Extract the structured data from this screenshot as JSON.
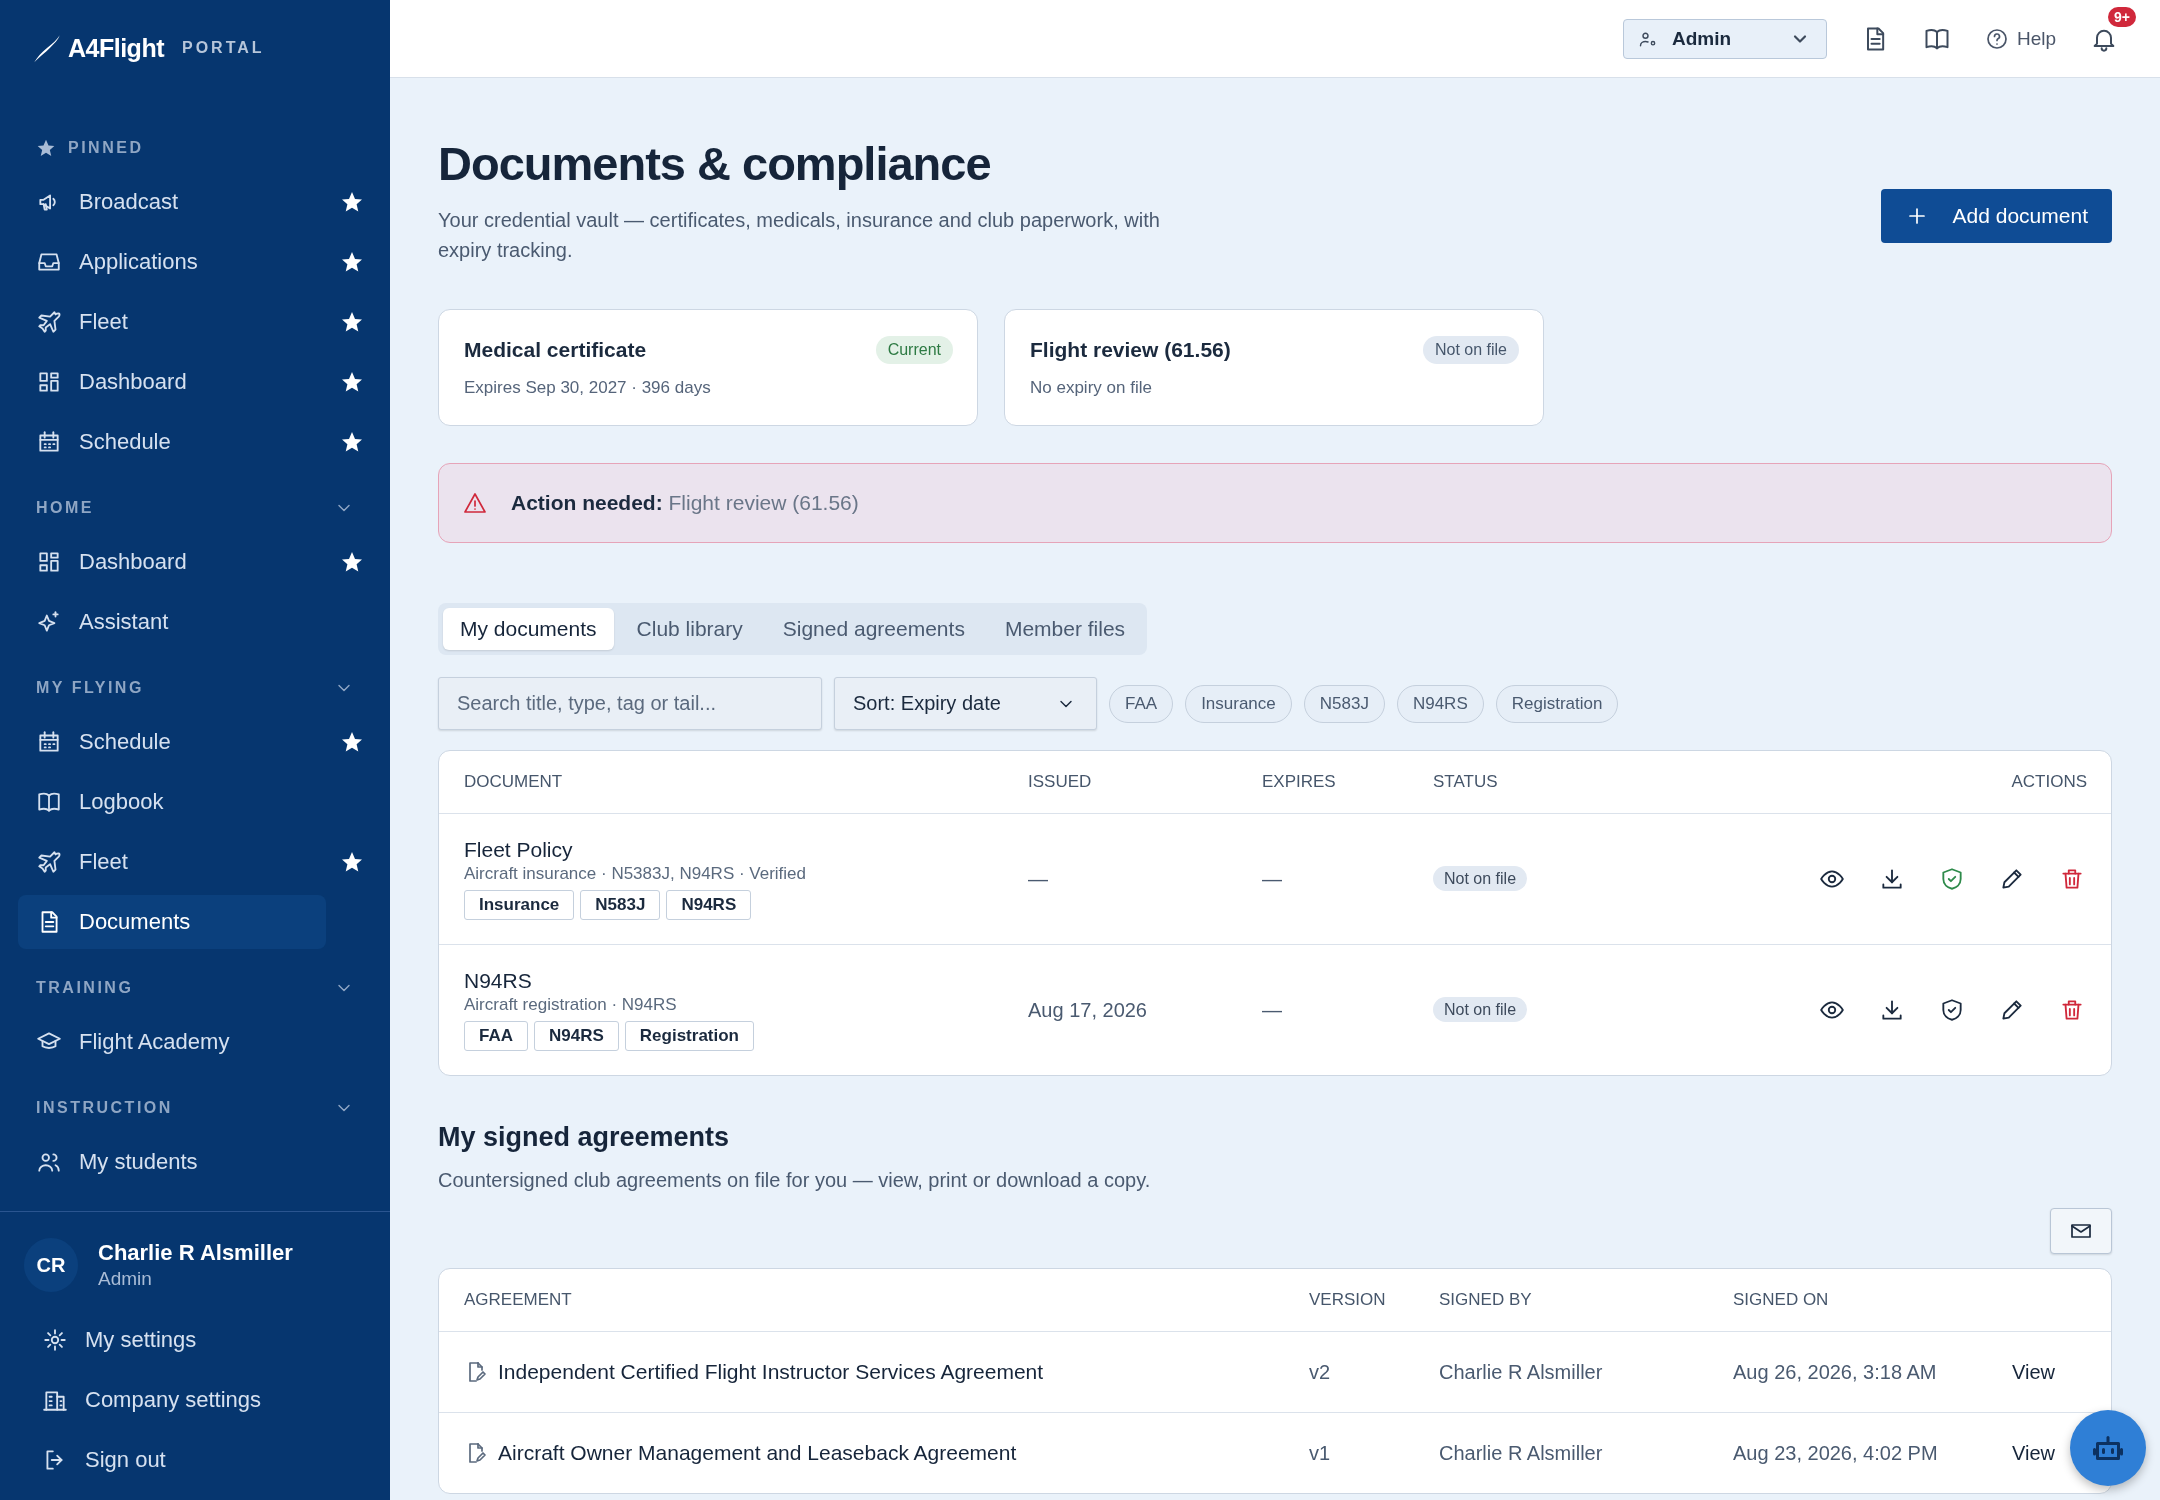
{
  "brand": {
    "name": "A4Flight",
    "tag": "PORTAL"
  },
  "sidebar": {
    "sections": [
      {
        "kind": "pinned",
        "title": "PINNED",
        "items": [
          {
            "label": "Broadcast",
            "pinned": true,
            "selected": false
          },
          {
            "label": "Applications",
            "pinned": true,
            "selected": false
          },
          {
            "label": "Fleet",
            "pinned": true,
            "selected": false
          },
          {
            "label": "Dashboard",
            "pinned": true,
            "selected": false
          },
          {
            "label": "Schedule",
            "pinned": true,
            "selected": false
          }
        ]
      },
      {
        "kind": "group",
        "title": "HOME",
        "expanded": true,
        "items": [
          {
            "label": "Dashboard",
            "pinned": true,
            "selected": false
          },
          {
            "label": "Assistant",
            "pinned": false,
            "selected": false
          }
        ]
      },
      {
        "kind": "group",
        "title": "MY FLYING",
        "expanded": true,
        "items": [
          {
            "label": "Schedule",
            "pinned": true,
            "selected": false
          },
          {
            "label": "Logbook",
            "pinned": false,
            "selected": false
          },
          {
            "label": "Fleet",
            "pinned": true,
            "selected": false
          },
          {
            "label": "Documents",
            "pinned": false,
            "selected": true
          }
        ]
      },
      {
        "kind": "group",
        "title": "TRAINING",
        "expanded": true,
        "items": [
          {
            "label": "Flight Academy",
            "pinned": false,
            "selected": false
          }
        ]
      },
      {
        "kind": "group",
        "title": "INSTRUCTION",
        "expanded": true,
        "items": [
          {
            "label": "My students",
            "pinned": false,
            "selected": false
          }
        ]
      }
    ],
    "user": {
      "initials": "CR",
      "name": "Charlie R Alsmiller",
      "role": "Admin"
    },
    "account_links": [
      "My settings",
      "Company settings",
      "Sign out"
    ]
  },
  "topbar": {
    "role_select": "Admin",
    "help": "Help",
    "notifications": "9+"
  },
  "page": {
    "title": "Documents & compliance",
    "subtitle": "Your credential vault — certificates, medicals, insurance and club paperwork, with expiry tracking.",
    "add_button": "Add document"
  },
  "status_cards": [
    {
      "title": "Medical certificate",
      "badge": "Current",
      "current": true,
      "detail": "Expires Sep 30, 2027 · 396 days"
    },
    {
      "title": "Flight review (61.56)",
      "badge": "Not on file",
      "current": false,
      "detail": "No expiry on file"
    }
  ],
  "alert": {
    "text": "**Action needed:** Flight review (61.56)"
  },
  "tabs": [
    {
      "label": "My documents",
      "selected": true
    },
    {
      "label": "Club library",
      "selected": false
    },
    {
      "label": "Signed agreements",
      "selected": false
    },
    {
      "label": "Member files",
      "selected": false
    }
  ],
  "search": {
    "placeholder": "Search title, type, tag or tail..."
  },
  "sort": "Sort: Expiry date",
  "filter_chips": [
    {
      "label": "FAA",
      "selected": false
    },
    {
      "label": "Insurance",
      "selected": false
    },
    {
      "label": "N583J",
      "selected": false
    },
    {
      "label": "N94RS",
      "selected": false
    },
    {
      "label": "Registration",
      "selected": false
    }
  ],
  "documents": {
    "columns": [
      "DOCUMENT",
      "ISSUED",
      "EXPIRES",
      "STATUS",
      "ACTIONS"
    ],
    "rows": [
      {
        "title": "Fleet Policy",
        "subtitle": "Aircraft insurance · N5383J, N94RS · Verified",
        "tags": [
          "Insurance",
          "N583J",
          "N94RS"
        ],
        "issued": "—",
        "expires": "—",
        "status": "Not on file",
        "verified": true
      },
      {
        "title": "N94RS",
        "subtitle": "Aircraft registration · N94RS",
        "tags": [
          "FAA",
          "N94RS",
          "Registration"
        ],
        "issued": "Aug 17, 2026",
        "expires": "—",
        "status": "Not on file",
        "verified": false
      }
    ]
  },
  "agreements": {
    "title": "My signed agreements",
    "subtitle": "Countersigned club agreements on file for you — view, print or download a copy.",
    "columns": [
      "AGREEMENT",
      "VERSION",
      "SIGNED BY",
      "SIGNED ON"
    ],
    "rows": [
      {
        "name": "Independent Certified Flight Instructor Services Agreement",
        "version": "v2",
        "signed_by": "Charlie R Alsmiller",
        "signed_on": "Aug 26, 2026, 3:18 AM",
        "action": "View"
      },
      {
        "name": "Aircraft Owner Management and Leaseback Agreement",
        "version": "v1",
        "signed_by": "Charlie R Alsmiller",
        "signed_on": "Aug 23, 2026, 4:02 PM",
        "action": "View"
      }
    ]
  }
}
